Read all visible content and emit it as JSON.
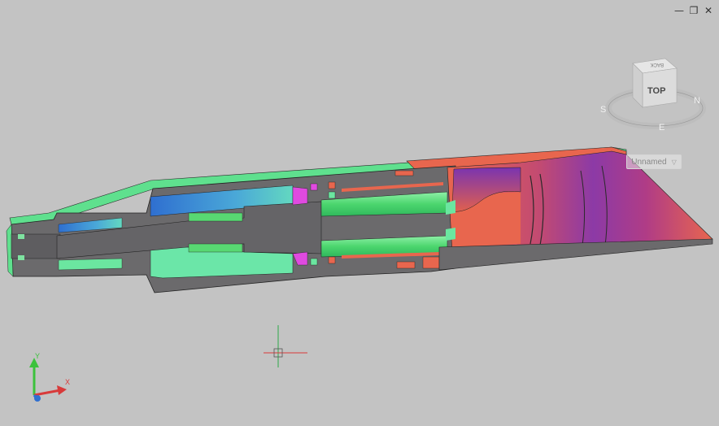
{
  "window": {
    "minimize_glyph": "—",
    "restore_glyph": "❐",
    "close_glyph": "✕"
  },
  "viewcube": {
    "face_label": "TOP",
    "back_label": "BACK",
    "compass": {
      "south": "S",
      "east": "E",
      "north": "N"
    }
  },
  "view_dropdown": {
    "label": "Unnamed",
    "chevron": "▽"
  },
  "ucs": {
    "x_label": "X",
    "y_label": "Y"
  },
  "colors": {
    "background": "#c3c3c3",
    "section_gray": "#6b6a6c",
    "green": "#5fe08e",
    "blue": "#3f8bd6",
    "orange": "#e8664e",
    "purple": "#8a3aa8",
    "magenta": "#e04ae0",
    "crosshair_red": "#d83a3a",
    "crosshair_green": "#2ea84a"
  }
}
